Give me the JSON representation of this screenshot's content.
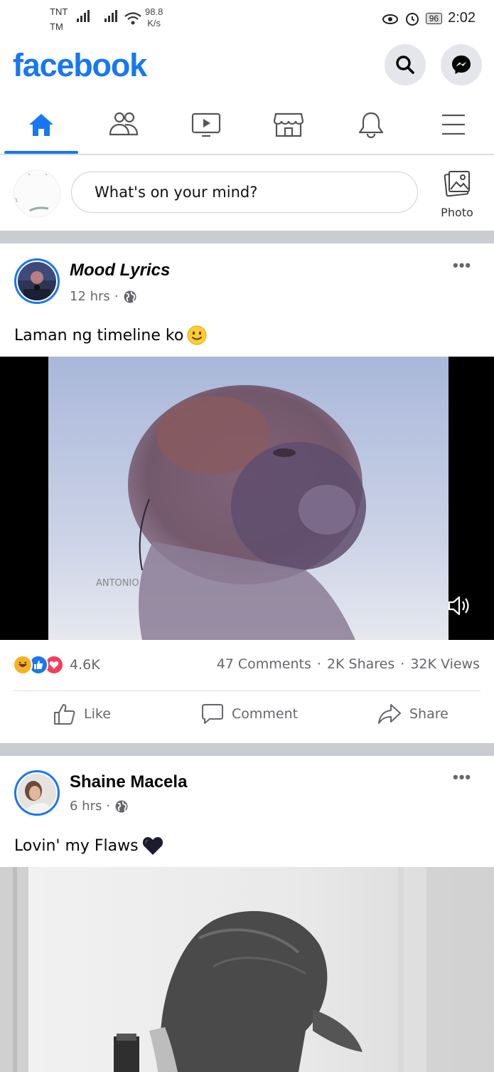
{
  "status_bar": {
    "carrier1": "TNT",
    "carrier2": "TM",
    "speed_value": "98.8",
    "speed_unit": "K/s",
    "battery": "96",
    "time": "2:02"
  },
  "header": {
    "logo": "facebook",
    "search_icon": "search-icon",
    "messenger_icon": "messenger-icon",
    "brand_color": "#1877f2"
  },
  "nav": {
    "tabs": [
      {
        "icon": "home-icon",
        "active": true
      },
      {
        "icon": "friends-icon",
        "active": false
      },
      {
        "icon": "watch-icon",
        "active": false
      },
      {
        "icon": "marketplace-icon",
        "active": false
      },
      {
        "icon": "bell-icon",
        "active": false
      },
      {
        "icon": "menu-icon",
        "active": false
      }
    ]
  },
  "composer": {
    "placeholder": "What's on your mind?",
    "photo_label": "Photo"
  },
  "posts": [
    {
      "author": "Mood Lyrics",
      "time": "12 hrs",
      "privacy_icon": "globe-icon",
      "text": "Laman ng timeline ko",
      "text_emoji": "slightly-smiling-face",
      "video_watermark": "ANTONIO",
      "reactions": [
        "haha",
        "like",
        "love"
      ],
      "reaction_count": "4.6K",
      "comments": "47 Comments",
      "shares": "2K Shares",
      "views": "32K Views",
      "actions": {
        "like": "Like",
        "comment": "Comment",
        "share": "Share"
      }
    },
    {
      "author": "Shaine Macela",
      "time": "6 hrs",
      "privacy_icon": "globe-icon",
      "text": "Lovin' my Flaws",
      "text_emoji": "black-heart"
    }
  ]
}
